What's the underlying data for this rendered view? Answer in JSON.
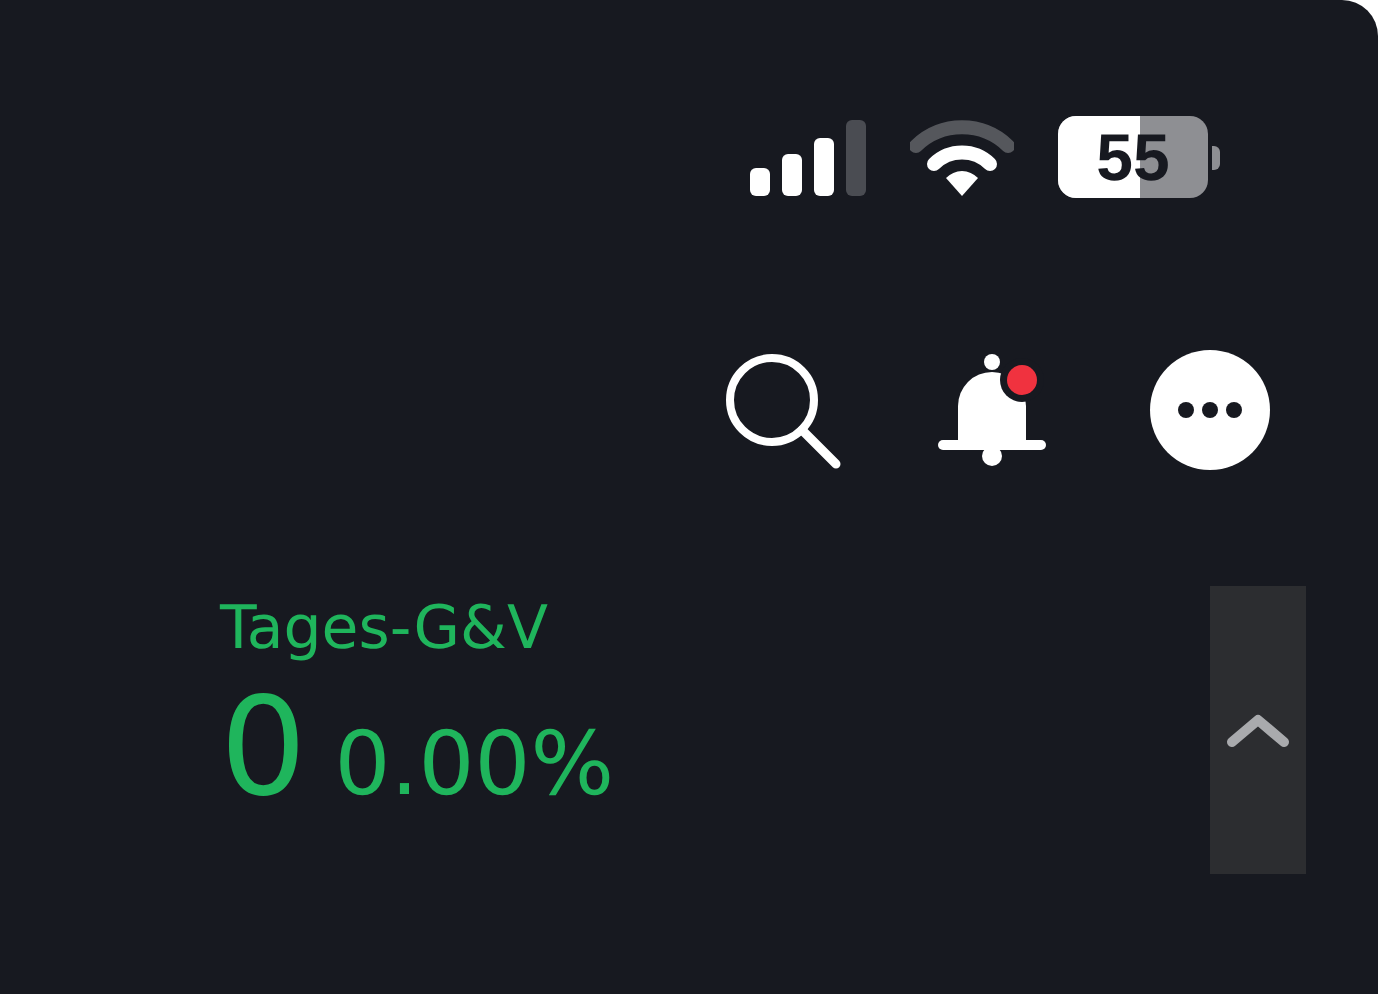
{
  "status_bar": {
    "battery": "55"
  },
  "header": {
    "notification_unread": true
  },
  "pnl": {
    "label": "Tages-G&V",
    "value": "0",
    "percent": "0.00%"
  }
}
